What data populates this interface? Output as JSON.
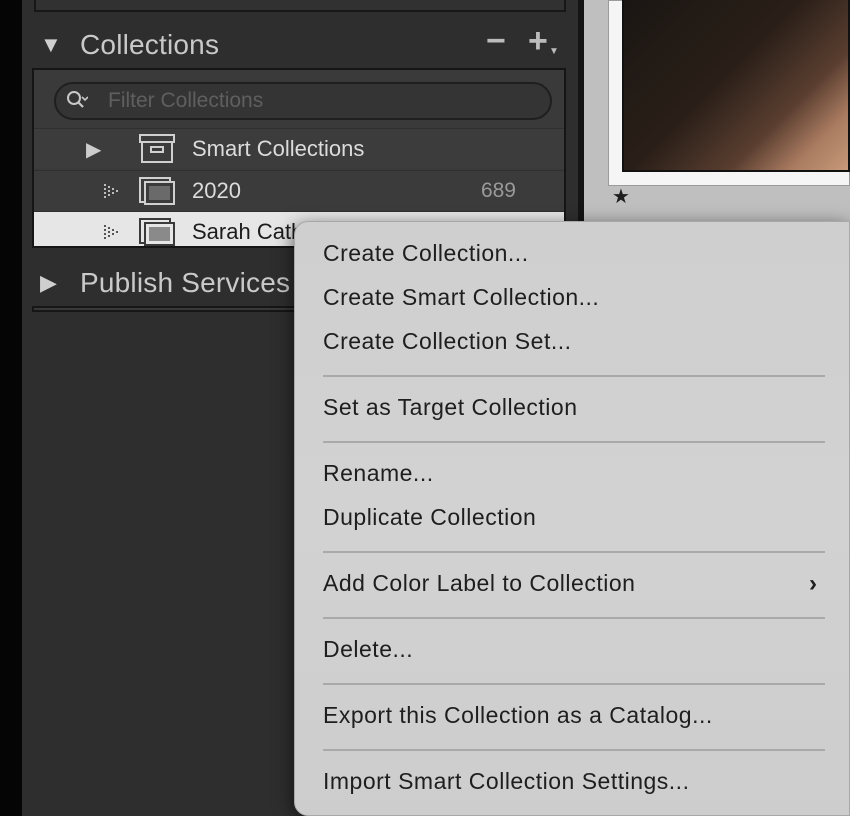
{
  "collections_panel": {
    "title": "Collections",
    "minus_symbol": "−",
    "plus_symbol": "+",
    "filter_placeholder": "Filter Collections",
    "rows": [
      {
        "name": "Smart Collections",
        "count": "",
        "icon": "collection-set-icon",
        "expandable": true
      },
      {
        "name": "2020",
        "count": "689",
        "icon": "collection-icon",
        "expandable": false
      },
      {
        "name": "Sarah Cath",
        "count": "",
        "icon": "collection-icon",
        "expandable": false,
        "selected": true
      }
    ]
  },
  "publish_services": {
    "title": "Publish Services"
  },
  "preview": {
    "star": "★"
  },
  "context_menu": {
    "items": [
      "Create Collection...",
      "Create Smart Collection...",
      "Create Collection Set...",
      "Set as Target Collection",
      "Rename...",
      "Duplicate Collection",
      "Add Color Label to Collection",
      "Delete...",
      "Export this Collection as a Catalog...",
      "Import Smart Collection Settings..."
    ],
    "submenu_arrow": "›"
  }
}
